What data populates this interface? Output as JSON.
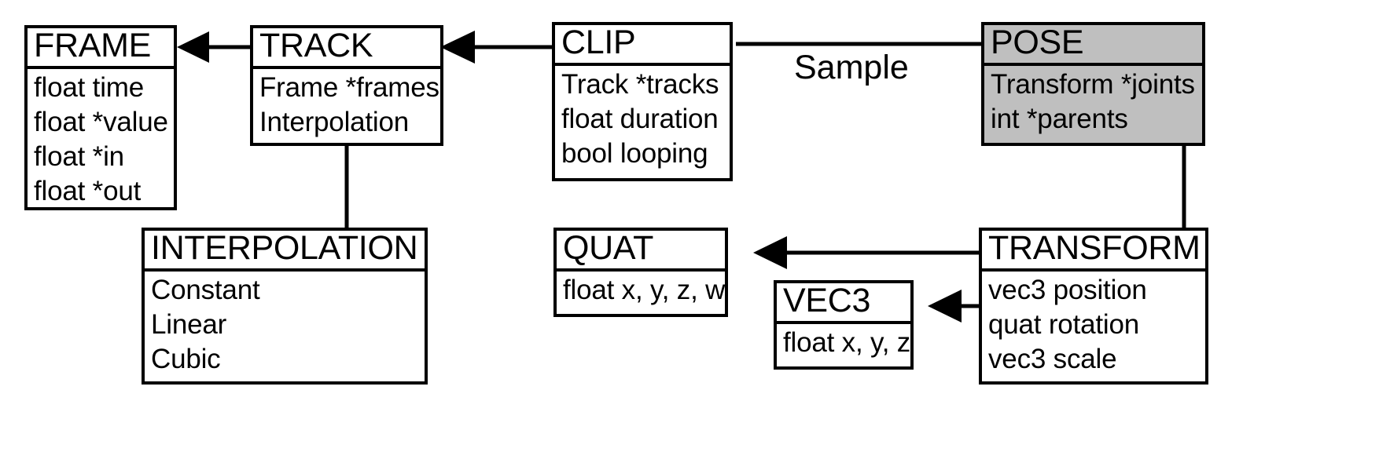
{
  "diagram": {
    "title": "Animation data structures class diagram",
    "background_color": "#ffffff",
    "line_color": "#000000",
    "shaded_fill_color": "#bfbfbf",
    "classes": [
      {
        "id": "frame",
        "name": "FRAME",
        "shaded": false,
        "fields": [
          "float time",
          "float *value",
          "float *in",
          "float *out"
        ]
      },
      {
        "id": "track",
        "name": "TRACK",
        "shaded": false,
        "fields": [
          "Frame *frames",
          "Interpolation"
        ]
      },
      {
        "id": "clip",
        "name": "CLIP",
        "shaded": false,
        "fields": [
          "Track *tracks",
          "float duration",
          "bool looping"
        ]
      },
      {
        "id": "pose",
        "name": "POSE",
        "shaded": true,
        "fields": [
          "Transform *joints",
          "int *parents"
        ]
      },
      {
        "id": "interpolation",
        "name": "INTERPOLATION",
        "shaded": false,
        "fields": [
          "Constant",
          "Linear",
          "Cubic"
        ]
      },
      {
        "id": "quat",
        "name": "QUAT",
        "shaded": false,
        "fields": [
          "float x, y, z, w"
        ]
      },
      {
        "id": "vec3",
        "name": "VEC3",
        "shaded": false,
        "fields": [
          "float x, y, z"
        ]
      },
      {
        "id": "transform",
        "name": "TRANSFORM",
        "shaded": false,
        "fields": [
          "vec3 position",
          "quat rotation",
          "vec3 scale"
        ]
      }
    ],
    "edges": [
      {
        "id": "track-to-frame",
        "from": "TRACK",
        "to": "FRAME",
        "label": ""
      },
      {
        "id": "clip-to-track",
        "from": "CLIP",
        "to": "TRACK",
        "label": ""
      },
      {
        "id": "clip-to-pose",
        "from": "CLIP",
        "to": "POSE",
        "label": "Sample"
      },
      {
        "id": "track-to-interpolation",
        "from": "TRACK",
        "to": "INTERPOLATION",
        "label": ""
      },
      {
        "id": "pose-to-transform",
        "from": "POSE",
        "to": "TRANSFORM",
        "label": ""
      },
      {
        "id": "transform-to-quat",
        "from": "TRANSFORM",
        "to": "QUAT",
        "label": ""
      },
      {
        "id": "transform-to-vec3",
        "from": "TRANSFORM",
        "to": "VEC3",
        "label": ""
      }
    ]
  }
}
